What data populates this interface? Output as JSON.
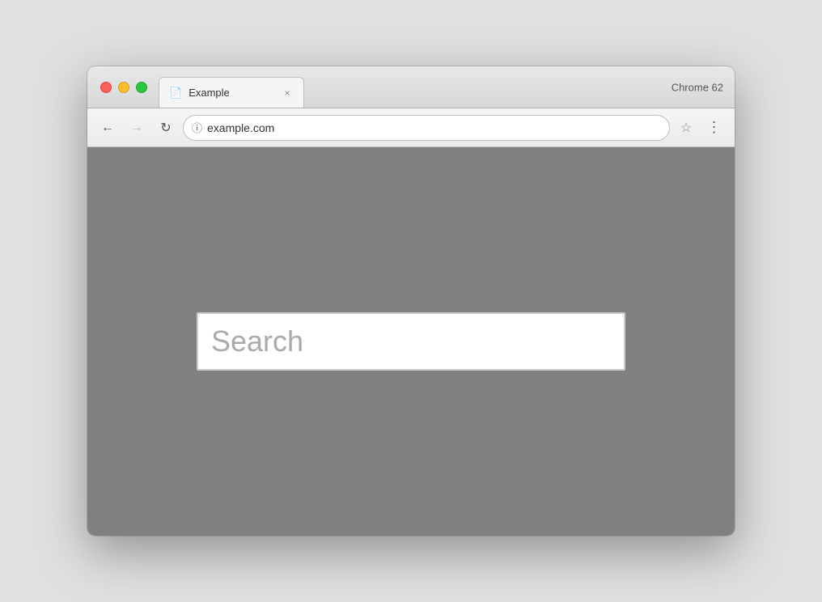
{
  "browser": {
    "chrome_version": "Chrome 62",
    "traffic_lights": {
      "close_label": "",
      "minimize_label": "",
      "maximize_label": ""
    },
    "tab": {
      "icon": "📄",
      "title": "Example",
      "close_symbol": "×"
    },
    "toolbar": {
      "back_symbol": "←",
      "forward_symbol": "→",
      "reload_symbol": "↻",
      "security_icon": "ⓘ",
      "address": "example.com",
      "bookmark_symbol": "☆",
      "menu_symbol": "⋮"
    }
  },
  "webpage": {
    "search_placeholder": "Search"
  }
}
